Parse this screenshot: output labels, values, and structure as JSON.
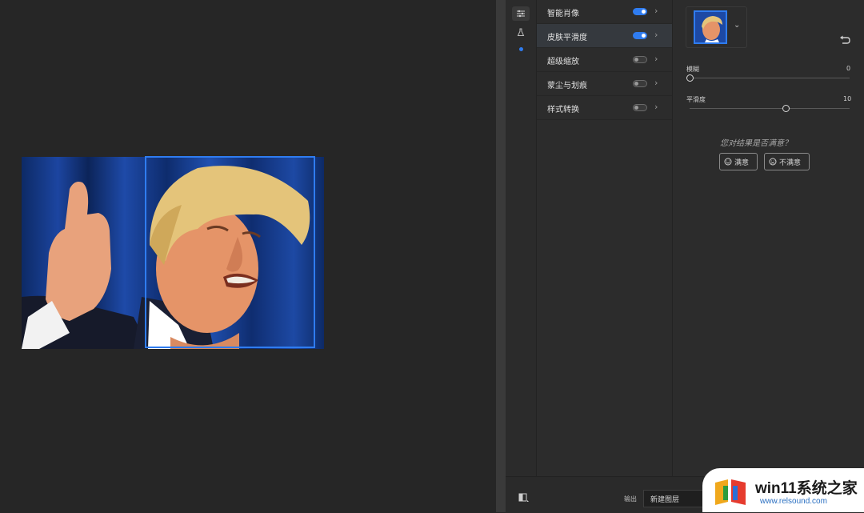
{
  "panel": {
    "features": [
      {
        "label": "智能肖像",
        "enabled": true,
        "selected": false
      },
      {
        "label": "皮肤平滑度",
        "enabled": true,
        "selected": true
      },
      {
        "label": "超级缩放",
        "enabled": false,
        "selected": false
      },
      {
        "label": "蒙尘与划痕",
        "enabled": false,
        "selected": false
      },
      {
        "label": "样式转换",
        "enabled": false,
        "selected": false
      }
    ]
  },
  "props": {
    "sliders": [
      {
        "label": "模糊",
        "value": "0",
        "level": 0.0
      },
      {
        "label": "平滑度",
        "value": "10",
        "level": 0.6
      }
    ],
    "question": "您对结果是否满意？",
    "satisfied": "满意",
    "unsatisfied": "不满意"
  },
  "footer": {
    "output_label": "输出",
    "output_value": "新建图层"
  },
  "watermark": {
    "title": "win11系统之家",
    "url": "www.relsound.com"
  },
  "colors": {
    "accent": "#2f7cf0",
    "background": "#262626",
    "panel": "#2c2c2c"
  }
}
